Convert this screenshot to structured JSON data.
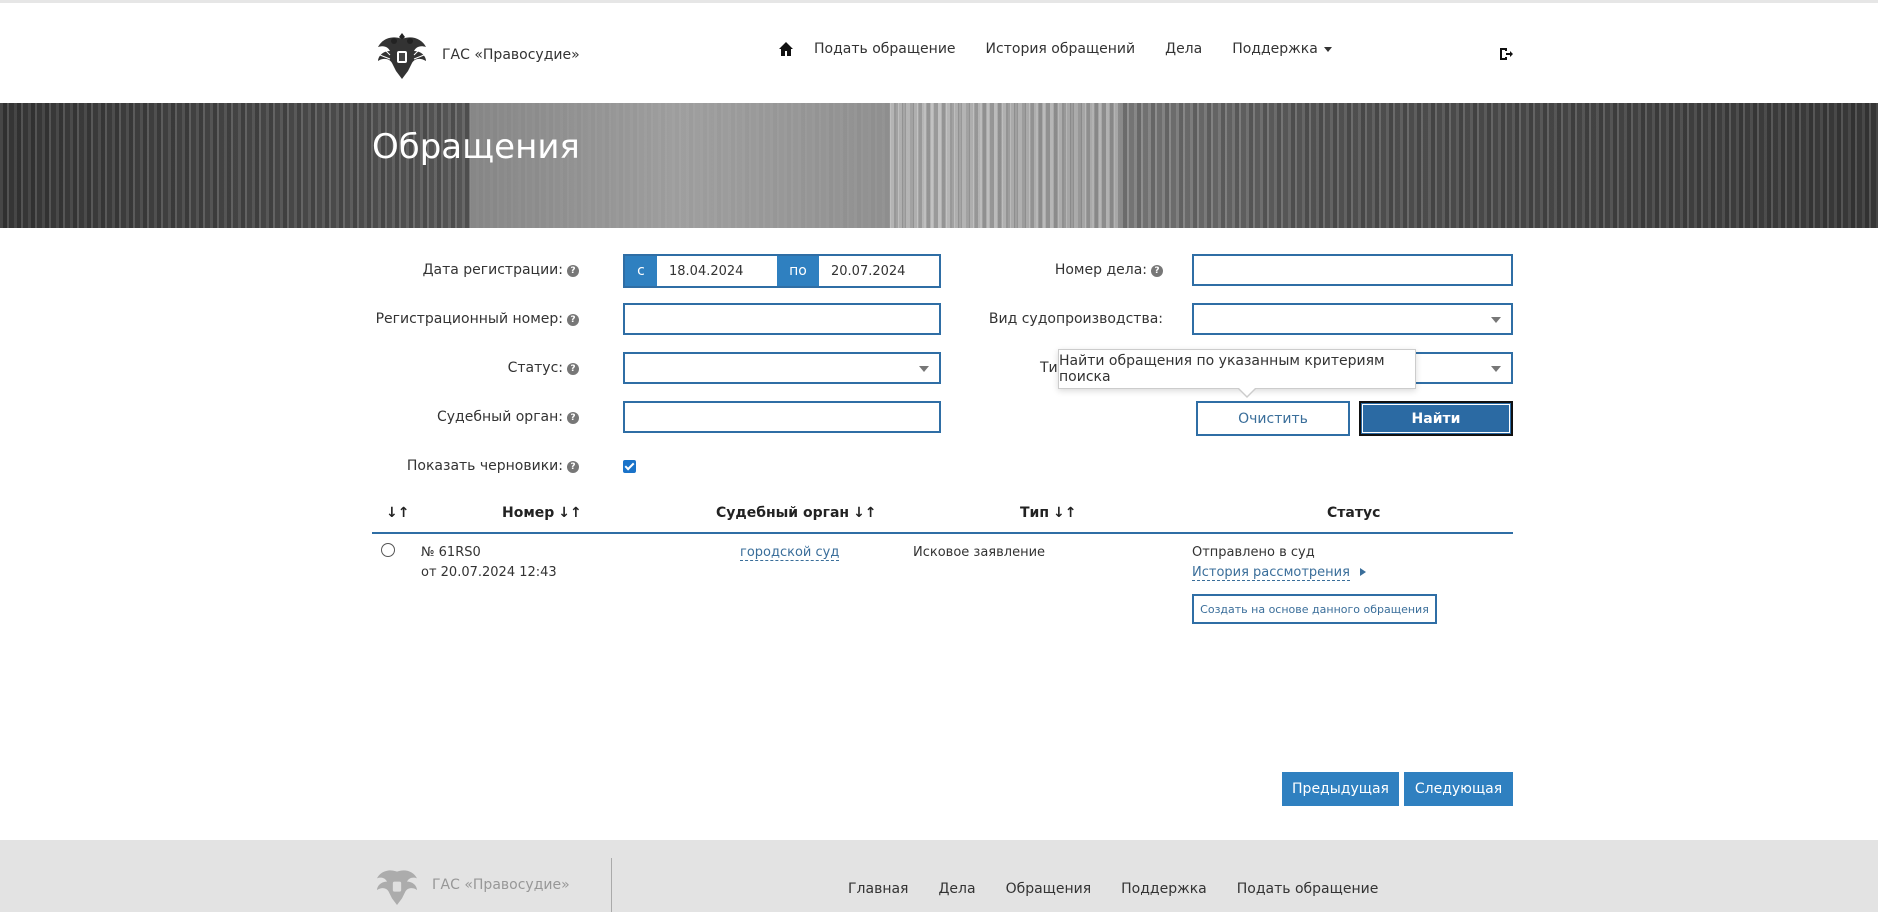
{
  "header": {
    "brand": "ГАС «Правосудие»",
    "nav": [
      "Подать обращение",
      "История обращений",
      "Дела",
      "Поддержка"
    ]
  },
  "banner": {
    "title": "Обращения"
  },
  "form": {
    "reg_date_label": "Дата регистрации:",
    "date_from_prefix": "с",
    "date_from": "18.04.2024",
    "date_to_prefix": "по",
    "date_to": "20.07.2024",
    "reg_number_label": "Регистрационный номер:",
    "status_label": "Статус:",
    "court_label": "Судебный орган:",
    "drafts_label": "Показать черновики:",
    "case_number_label": "Номер дела:",
    "proceeding_type_label": "Вид судопроизводства:",
    "type_label_visible": "Тип",
    "clear_button": "Очистить",
    "find_button": "Найти",
    "tooltip": "Найти обращения по указанным критериям поиска"
  },
  "table": {
    "headers": [
      "Номер",
      "Судебный орган",
      "Тип",
      "Статус"
    ],
    "rows": [
      {
        "number": "№ 61RS0",
        "date": "от 20.07.2024 12:43",
        "court": "городской суд",
        "type": "Исковое заявление",
        "status": "Отправлено в суд",
        "history_link": "История рассмотрения",
        "create_button": "Создать на основе данного обращения"
      }
    ]
  },
  "pagination": {
    "prev": "Предыдущая",
    "next": "Следующая"
  },
  "footer": {
    "brand": "ГАС «Правосудие»",
    "links": [
      "Главная",
      "Дела",
      "Обращения",
      "Поддержка",
      "Подать обращение"
    ]
  },
  "colors": {
    "accent": "#2f80c0",
    "border": "#2f6ea5",
    "footer_bg": "#e3e3e3"
  }
}
